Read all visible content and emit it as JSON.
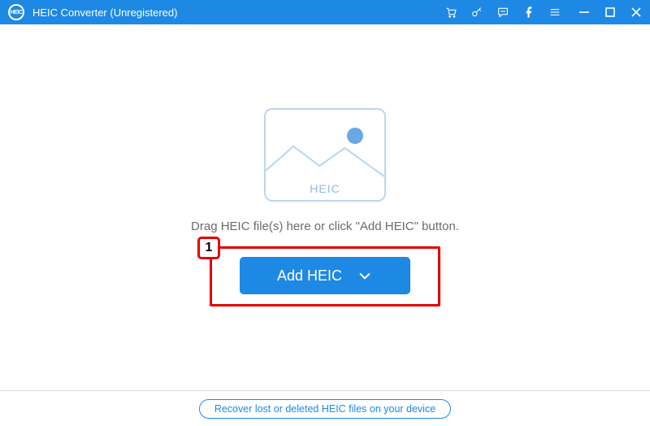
{
  "titlebar": {
    "app_title": "HEIC Converter (Unregistered)",
    "logo_text": "HEIC"
  },
  "main": {
    "placeholder_label": "HEIC",
    "instruction": "Drag HEIC file(s) here or click \"Add HEIC\" button.",
    "add_button_label": "Add HEIC"
  },
  "annotation": {
    "step_number": "1"
  },
  "footer": {
    "recover_link_label": "Recover lost or deleted HEIC files on your device"
  },
  "colors": {
    "accent": "#1e88e5",
    "annotation": "#e30000"
  }
}
